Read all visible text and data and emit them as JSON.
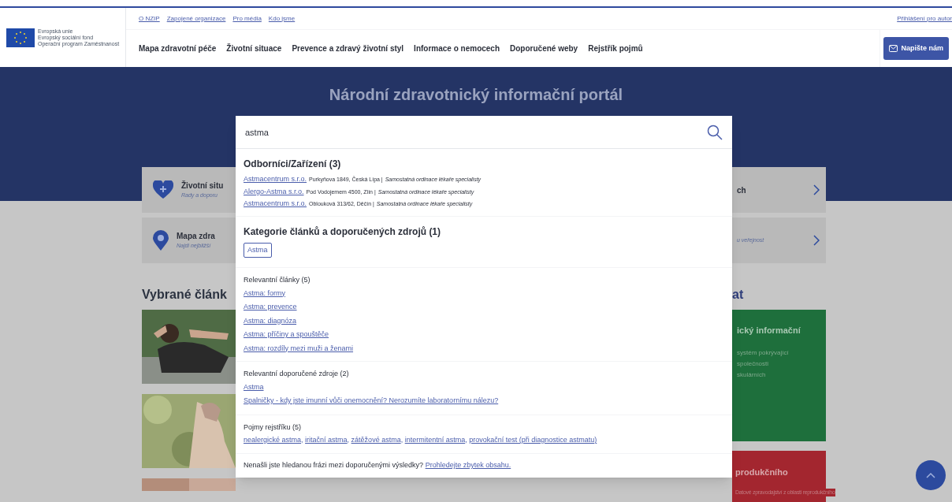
{
  "header": {
    "logo_text": [
      "Evropská unie",
      "Evropský sociální fond",
      "Operační program Zaměstnanost"
    ],
    "top_links": [
      "O NZIP",
      "Zapojené organizace",
      "Pro média",
      "Kdo jsme"
    ],
    "login_link": "Přihlášení pro autor",
    "nav": [
      "Mapa zdravotní péče",
      "Životní situace",
      "Prevence a zdravý životní styl",
      "Informace o nemocech",
      "Doporučené weby",
      "Rejstřík pojmů"
    ],
    "contact_button": "Napište nám"
  },
  "hero": {
    "title": "Národní zdravotnický informační portál"
  },
  "background": {
    "cards": [
      {
        "kind": "heart",
        "title": "Životní situ",
        "subtitle": "Rady a doporu",
        "right_title": "ch"
      },
      {
        "kind": "pin",
        "title": "Mapa zdra",
        "subtitle": "Najdi nejbližší",
        "right_subtitle": "u veřejnost"
      }
    ],
    "articles_heading": "Vybrané článk",
    "side_heading": "at",
    "green_card": {
      "title": "ický informační",
      "lines": [
        "systém pokrývající",
        "společnosti",
        "skulárních"
      ]
    },
    "red_card": {
      "title": "produkčního",
      "line": "Datové zpravodajství z oblasti reprodukčního"
    }
  },
  "search": {
    "value": "astma",
    "facilities": {
      "heading": "Odborníci/Zařízení (3)",
      "items": [
        {
          "name": "Astmacentrum s.r.o.",
          "address": "Purkyňova 1849, Česká Lípa |",
          "type": "Samostatná ordinace lékaře specialisty"
        },
        {
          "name": "Alergo-Astma s.r.o.",
          "address": "Pod Vodojemem 4500, Zlín |",
          "type": "Samostatná ordinace lékaře specialisty"
        },
        {
          "name": "Astmacentrum s.r.o.",
          "address": "Oblouková 313/62, Děčín |",
          "type": "Samostatná ordinace lékaře specialisty"
        }
      ]
    },
    "categories": {
      "heading": "Kategorie článků a doporučených zdrojů (1)",
      "tags": [
        "Astma"
      ]
    },
    "articles": {
      "heading": "Relevantní články (5)",
      "links": [
        "Astma: formy",
        "Astma: prevence",
        "Astma: diagnóza",
        "Astma: příčiny a spouštěče",
        "Astma: rozdíly mezi muži a ženami"
      ]
    },
    "sources": {
      "heading": "Relevantní doporučené zdroje (2)",
      "links": [
        "Astma",
        "Spalničky - kdy jste imunní vůči onemocnění? Nerozumíte laboratornímu nálezu?"
      ]
    },
    "terms": {
      "heading": "Pojmy rejstříku (5)",
      "separator": ",",
      "links": [
        "nealergické astma",
        "iritační astma",
        "zátěžové astma",
        "intermitentní astma",
        "provokační test (při diagnostice astmatu)"
      ]
    },
    "footer": {
      "text": "Nenašli jste hledanou frázi mezi doporučenými výsledky?",
      "link": "Prohledejte zbytek obsahu."
    }
  }
}
